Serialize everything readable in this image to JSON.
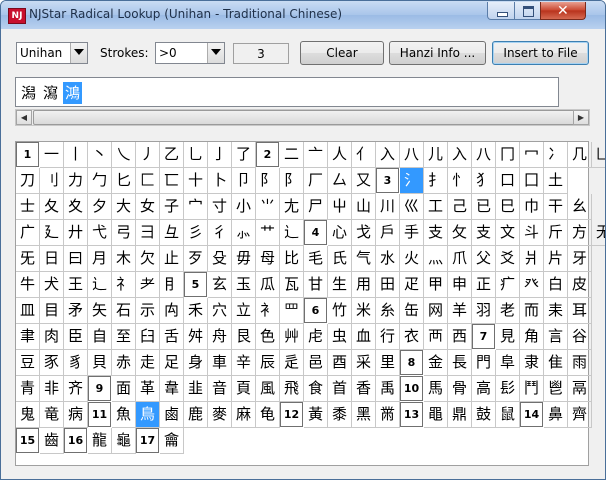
{
  "window": {
    "title": "NJStar Radical Lookup (Unihan - Traditional Chinese)",
    "icon_text": "NJ"
  },
  "toolbar": {
    "charset_value": "Unihan",
    "strokes_label": "Strokes:",
    "strokes_value": ">0",
    "count_value": "3",
    "clear_label": "Clear",
    "hanzi_info_label": "Hanzi Info ...",
    "insert_label": "Insert to File"
  },
  "input": {
    "chars": [
      "潟",
      "瀉"
    ],
    "selected_char": "鴻"
  },
  "scroll": {
    "left_arrow": "◀",
    "right_arrow": "▶"
  },
  "grid": {
    "rows": [
      [
        "1",
        "一",
        "丨",
        "丶",
        "乀",
        "丿",
        "乙",
        "乚",
        "亅",
        "了",
        "2",
        "二",
        "亠",
        "人",
        "亻",
        "入",
        "八",
        "儿",
        "入",
        "八",
        "冂",
        "冖",
        "冫",
        "几",
        "凵"
      ],
      [
        "刀",
        "刂",
        "力",
        "勹",
        "匕",
        "匚",
        "匸",
        "十",
        "卜",
        "卩",
        "阝",
        "阝",
        "厂",
        "厶",
        "又",
        "3",
        "氵",
        "扌",
        "忄",
        "犭",
        "口",
        "囗",
        "土"
      ],
      [
        "士",
        "夂",
        "夊",
        "夕",
        "大",
        "女",
        "子",
        "宀",
        "寸",
        "小",
        "⺌",
        "尢",
        "尸",
        "屮",
        "山",
        "川",
        "巛",
        "工",
        "己",
        "已",
        "巳",
        "巾",
        "干",
        "幺"
      ],
      [
        "广",
        "廴",
        "廾",
        "弋",
        "弓",
        "彐",
        "彑",
        "彡",
        "彳",
        "⺗",
        "艹",
        "辶",
        "4",
        "心",
        "戈",
        "戶",
        "手",
        "支",
        "攵",
        "支",
        "文",
        "斗",
        "斤",
        "方",
        "无"
      ],
      [
        "旡",
        "日",
        "曰",
        "月",
        "木",
        "欠",
        "止",
        "歹",
        "殳",
        "毋",
        "母",
        "比",
        "毛",
        "氏",
        "气",
        "水",
        "火",
        "灬",
        "爪",
        "父",
        "爻",
        "爿",
        "片",
        "牙"
      ],
      [
        "牛",
        "犬",
        "王",
        "辶",
        "礻",
        "耂",
        "⺝",
        "5",
        "玄",
        "玉",
        "瓜",
        "瓦",
        "甘",
        "生",
        "用",
        "田",
        "疋",
        "甲",
        "申",
        "正",
        "疒",
        "癶",
        "白",
        "皮"
      ],
      [
        "皿",
        "目",
        "矛",
        "矢",
        "石",
        "示",
        "禸",
        "禾",
        "穴",
        "立",
        "衤",
        "罒",
        "6",
        "竹",
        "米",
        "糸",
        "缶",
        "网",
        "羊",
        "羽",
        "老",
        "而",
        "耒",
        "耳"
      ],
      [
        "聿",
        "肉",
        "臣",
        "自",
        "至",
        "臼",
        "舌",
        "舛",
        "舟",
        "艮",
        "色",
        "艸",
        "虍",
        "虫",
        "血",
        "行",
        "衣",
        "襾",
        "西",
        "7",
        "見",
        "角",
        "言",
        "谷"
      ],
      [
        "豆",
        "豕",
        "豸",
        "貝",
        "赤",
        "走",
        "足",
        "身",
        "車",
        "辛",
        "辰",
        "辵",
        "邑",
        "酉",
        "采",
        "里",
        "8",
        "金",
        "長",
        "門",
        "阜",
        "隶",
        "隹",
        "雨"
      ],
      [
        "青",
        "非",
        "齐",
        "9",
        "面",
        "革",
        "韋",
        "韭",
        "音",
        "頁",
        "風",
        "飛",
        "食",
        "首",
        "香",
        "禹",
        "10",
        "馬",
        "骨",
        "高",
        "髟",
        "鬥",
        "鬯",
        "鬲"
      ],
      [
        "鬼",
        "竜",
        "病",
        "11",
        "魚",
        "鳥",
        "鹵",
        "鹿",
        "麥",
        "麻",
        "龟",
        "12",
        "黃",
        "黍",
        "黑",
        "黹",
        "13",
        "黽",
        "鼎",
        "鼓",
        "鼠",
        "14",
        "鼻",
        "齊"
      ],
      [
        "15",
        "齒",
        "16",
        "龍",
        "龜",
        "17",
        "龠"
      ]
    ]
  },
  "colors": {
    "selection": "#3399ff",
    "title_gradient_top": "#c9dcf3",
    "close_button": "#c9452e"
  }
}
